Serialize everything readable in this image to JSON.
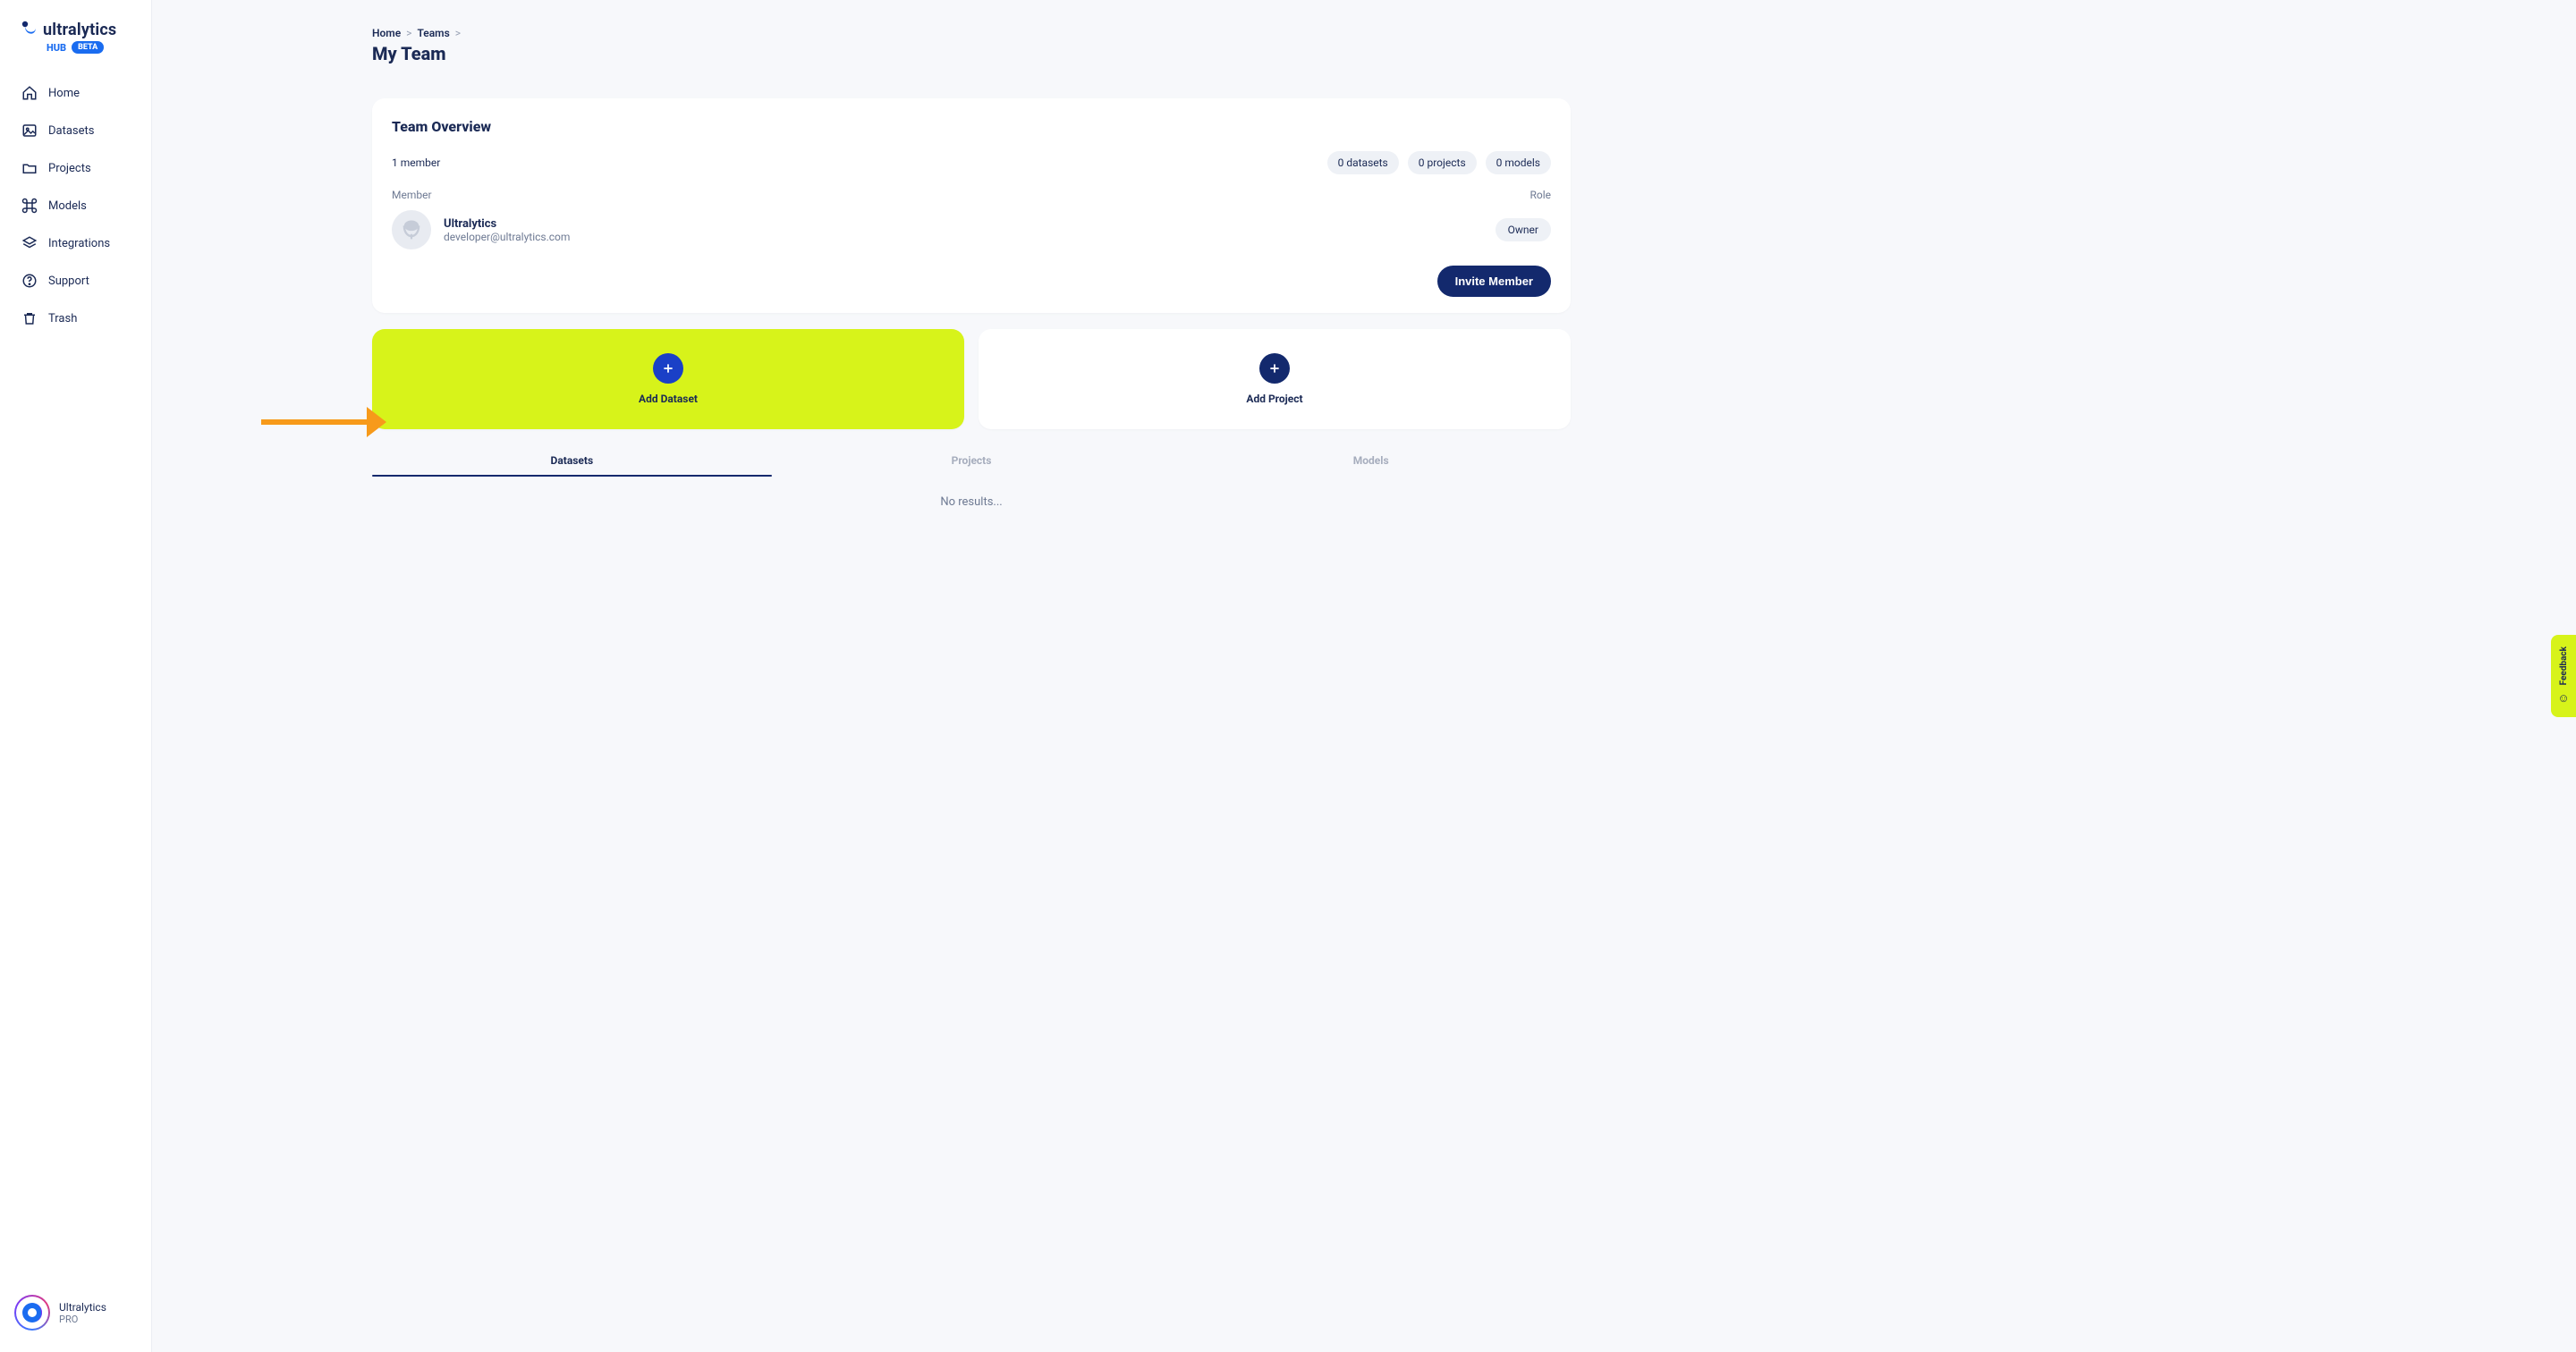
{
  "brand": {
    "word": "ultralytics",
    "sub": "HUB",
    "badge": "BETA"
  },
  "sidebar": {
    "items": [
      {
        "label": "Home"
      },
      {
        "label": "Datasets"
      },
      {
        "label": "Projects"
      },
      {
        "label": "Models"
      },
      {
        "label": "Integrations"
      },
      {
        "label": "Support"
      },
      {
        "label": "Trash"
      }
    ],
    "footer": {
      "name": "Ultralytics",
      "plan": "PRO"
    }
  },
  "breadcrumb": {
    "home": "Home",
    "teams": "Teams"
  },
  "page": {
    "title": "My Team"
  },
  "overview": {
    "title": "Team Overview",
    "member_count": "1 member",
    "chips": {
      "datasets": "0 datasets",
      "projects": "0 projects",
      "models": "0 models"
    },
    "col_member": "Member",
    "col_role": "Role",
    "member": {
      "name": "Ultralytics",
      "email": "developer@ultralytics.com",
      "role": "Owner"
    },
    "invite": "Invite Member"
  },
  "add": {
    "dataset": "Add Dataset",
    "project": "Add Project"
  },
  "tabs": {
    "datasets": "Datasets",
    "projects": "Projects",
    "models": "Models"
  },
  "empty": "No results...",
  "feedback": "Feedback"
}
